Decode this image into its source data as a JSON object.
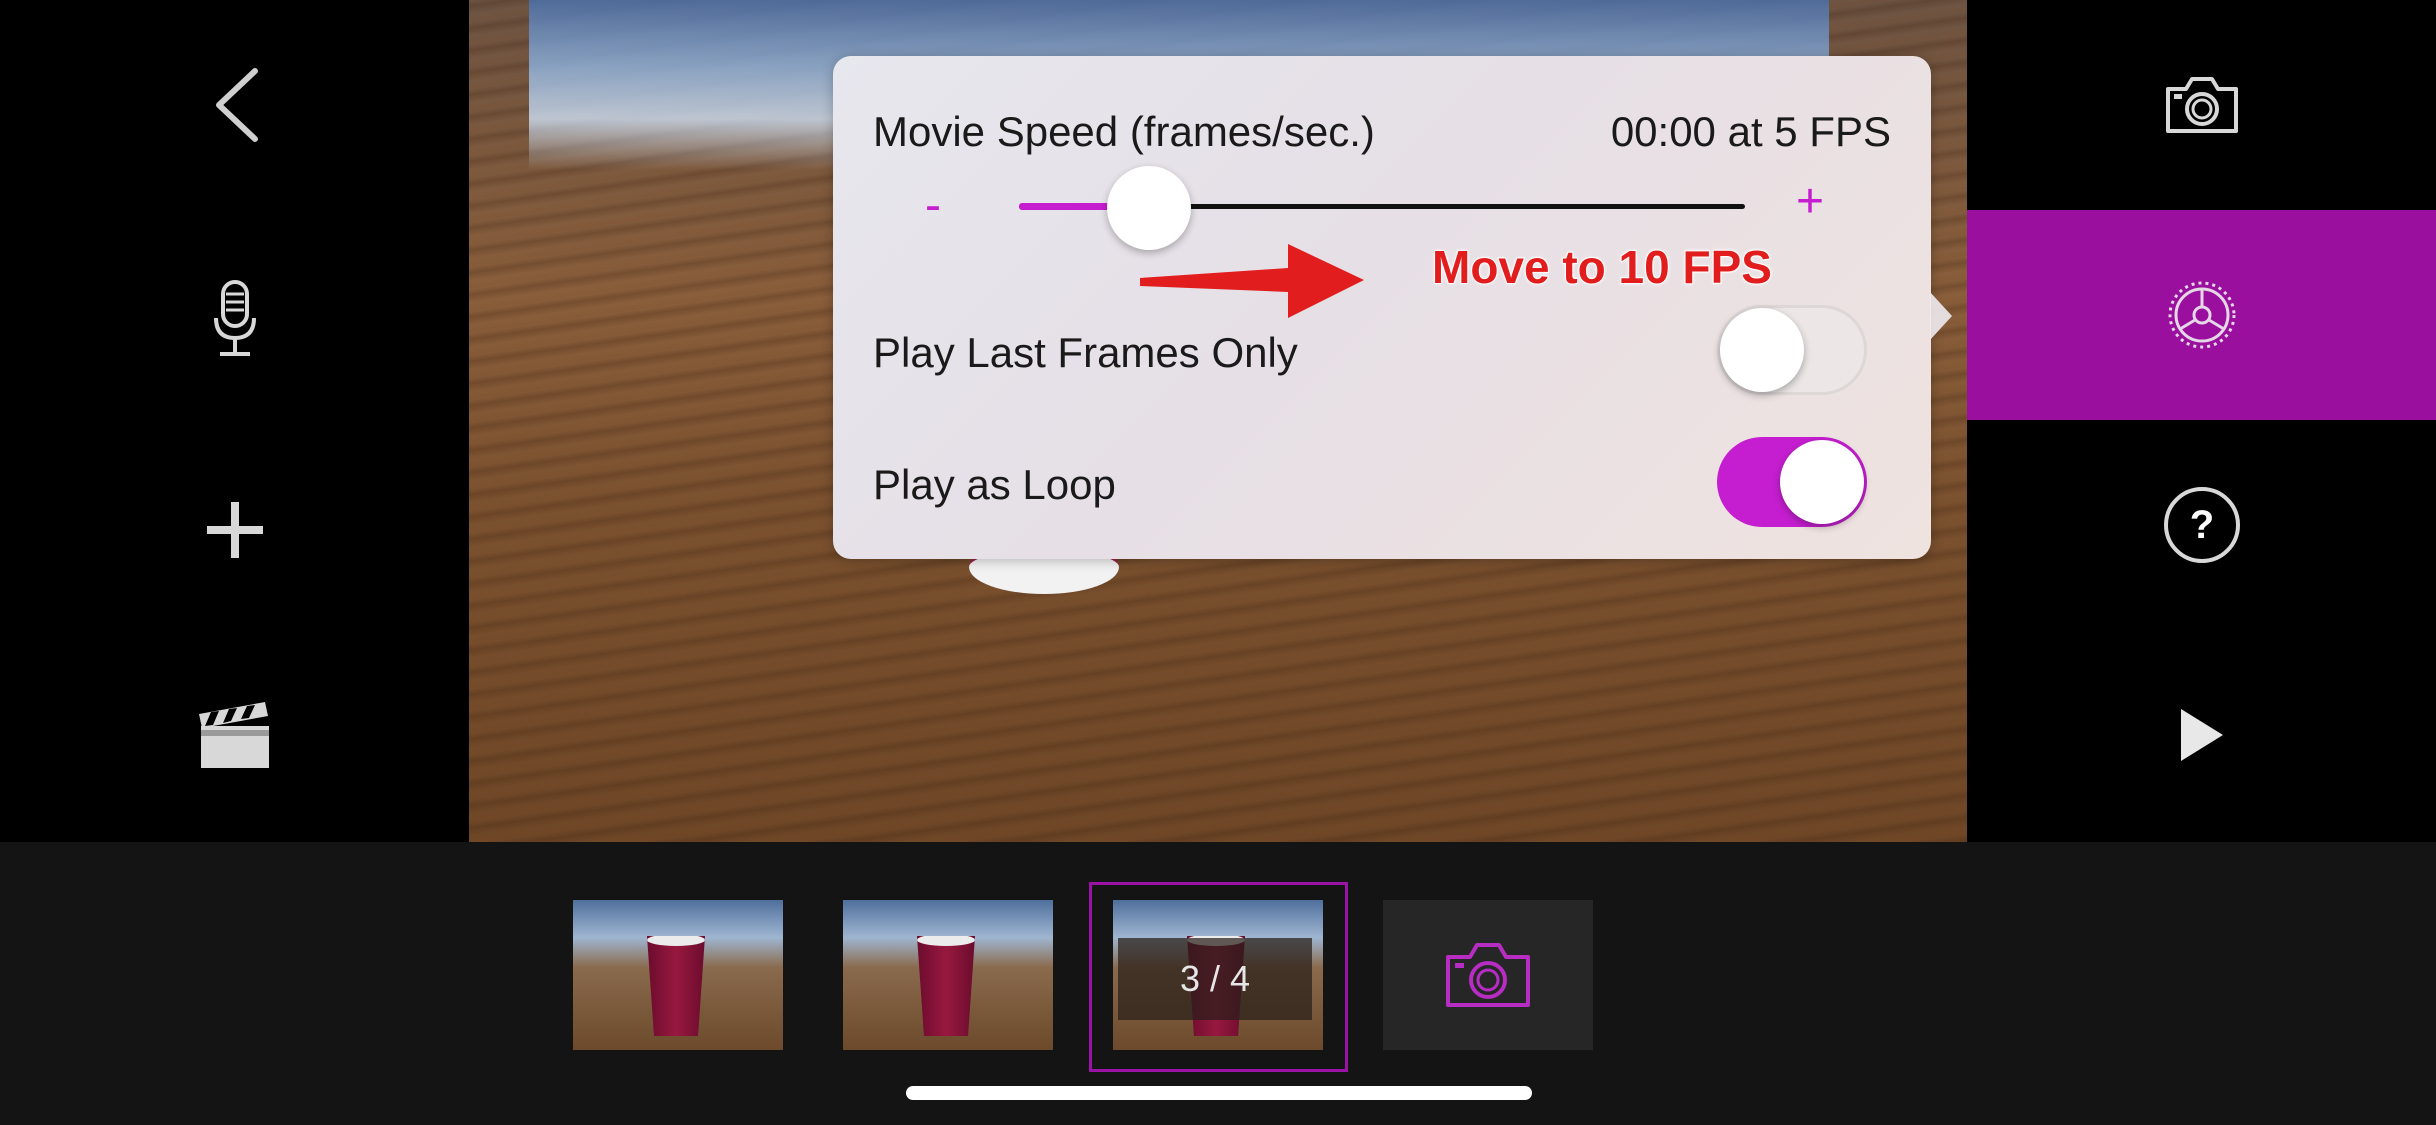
{
  "icons": {
    "back": "chevron-left-icon",
    "microphone": "microphone-icon",
    "add": "plus-icon",
    "clapperboard": "clapperboard-icon",
    "camera": "camera-icon",
    "settings": "settings-gear-icon",
    "help": "help-icon",
    "play": "play-icon"
  },
  "help": {
    "glyph": "?"
  },
  "settings_panel": {
    "speed": {
      "label": "Movie Speed (frames/sec.)",
      "value": "00:00 at 5 FPS",
      "minus": "-",
      "plus": "+",
      "slider_fraction": 0.12
    },
    "last_frames": {
      "label": "Play Last Frames Only",
      "on": false
    },
    "loop": {
      "label": "Play as Loop",
      "on": true
    }
  },
  "annotation": {
    "text": "Move to 10 FPS",
    "color": "#e21d1d"
  },
  "filmstrip": {
    "counter": "3 / 4",
    "selected_index": 3,
    "total": 4
  },
  "colors": {
    "accent": "#c51ed0",
    "active_tab": "#9b0f9e",
    "background": "#000000",
    "filmstrip_bg": "#141414"
  }
}
